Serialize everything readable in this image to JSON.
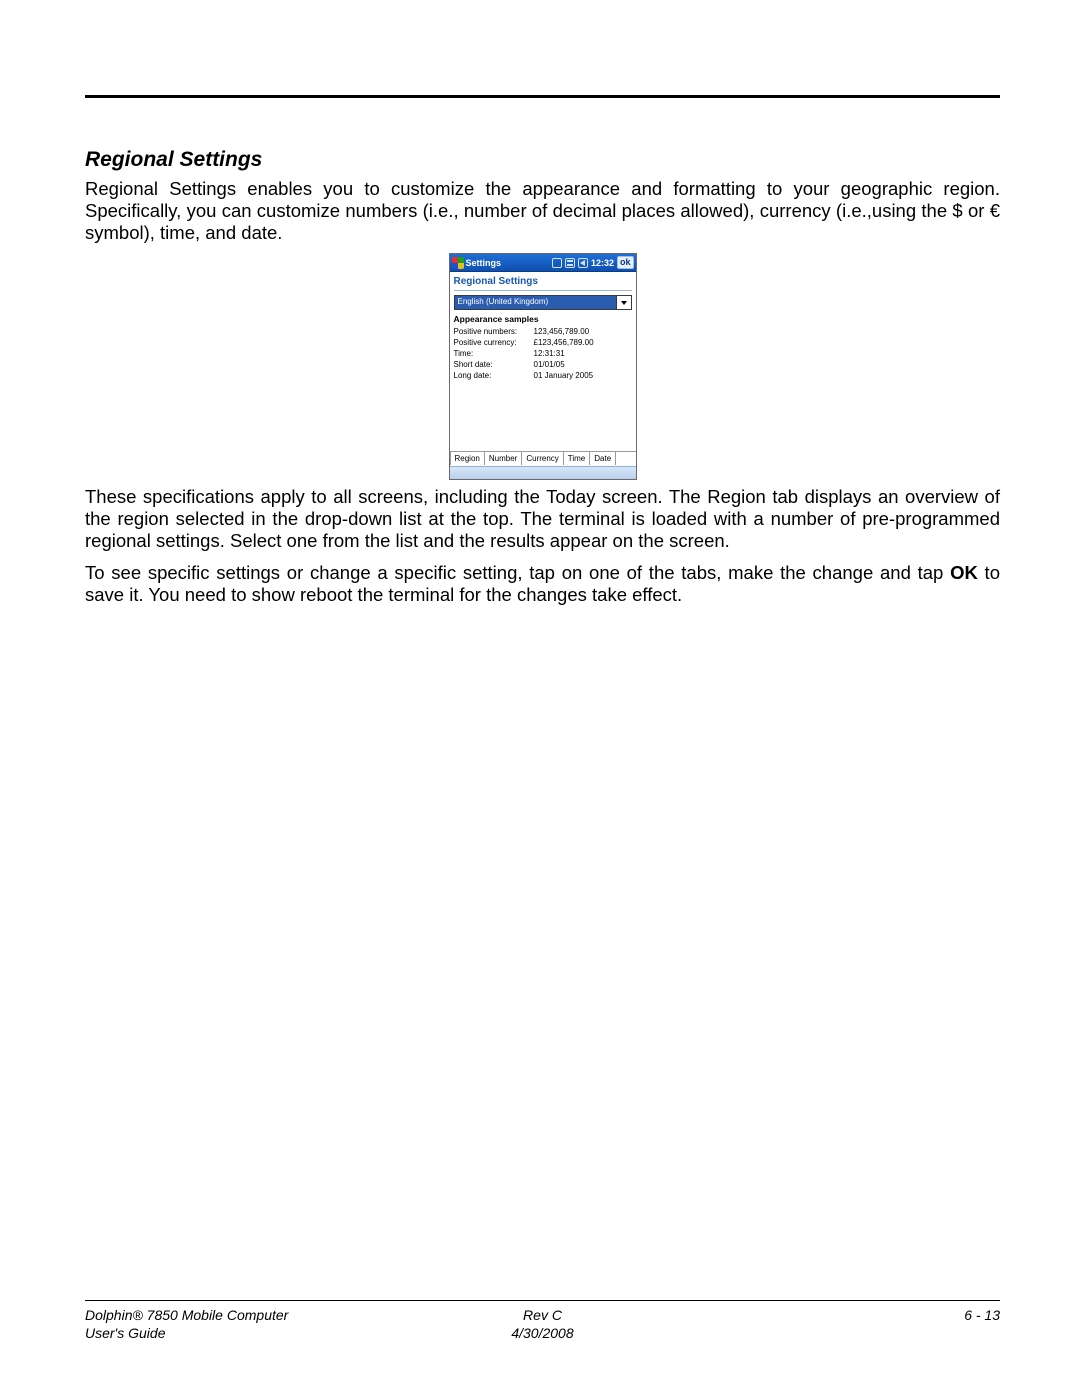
{
  "section": {
    "title": "Regional Settings",
    "para1": "Regional Settings enables you to customize the appearance and formatting to your geographic region. Specifically, you can customize numbers (i.e., number of decimal places allowed), currency (i.e.,using the $ or € symbol), time, and date.",
    "para2": "These specifications apply to all screens, including the Today screen. The Region tab displays an overview of the region selected in the drop-down list at the top. The terminal is loaded with a number of pre-programmed regional settings. Select one from the list and the results appear on the screen.",
    "para3_a": "To see specific settings or change a specific setting, tap on one of the tabs, make the change and tap ",
    "para3_b": "OK",
    "para3_c": " to save it. You need to show reboot the terminal for the changes take effect."
  },
  "screenshot": {
    "titlebar": {
      "title": "Settings",
      "clock": "12:32",
      "ok": "ok"
    },
    "header": "Regional Settings",
    "combo_value": "English (United Kingdom)",
    "samples_header": "Appearance samples",
    "rows": [
      {
        "label": "Positive numbers:",
        "value": "123,456,789.00"
      },
      {
        "label": "Positive currency:",
        "value": "£123,456,789.00"
      },
      {
        "label": "Time:",
        "value": "12:31:31"
      },
      {
        "label": "Short date:",
        "value": "01/01/05"
      },
      {
        "label": "Long date:",
        "value": "01 January 2005"
      }
    ],
    "tabs": [
      "Region",
      "Number",
      "Currency",
      "Time",
      "Date"
    ],
    "active_tab": 0
  },
  "footer": {
    "left_line1": "Dolphin® 7850 Mobile Computer",
    "left_line2": "User's Guide",
    "center_line1": "Rev C",
    "center_line2": "4/30/2008",
    "right": "6 - 13"
  }
}
